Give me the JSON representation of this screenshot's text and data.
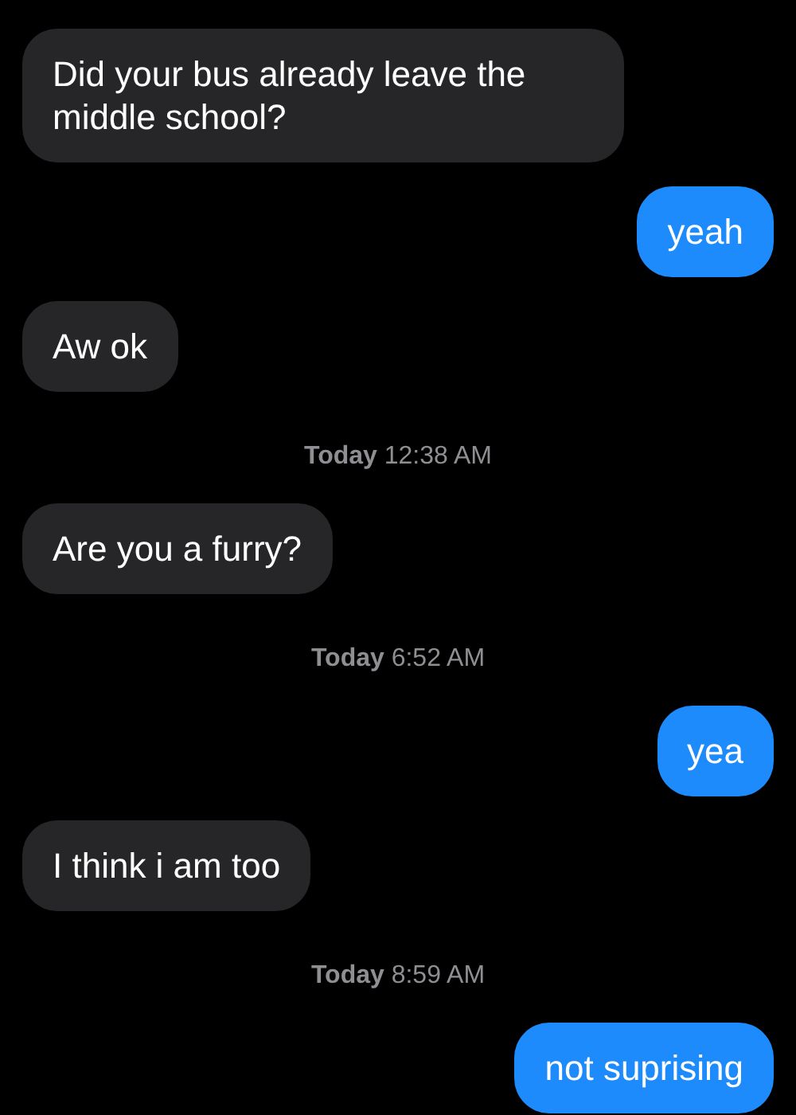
{
  "messages": [
    {
      "kind": "incoming",
      "text": "Did your bus already leave the middle school?"
    },
    {
      "kind": "outgoing",
      "text": "yeah"
    },
    {
      "kind": "incoming",
      "text": "Aw ok"
    },
    {
      "kind": "timestamp",
      "text": "**Today** 12:38 AM"
    },
    {
      "kind": "incoming",
      "text": "Are you a furry?"
    },
    {
      "kind": "timestamp",
      "text": "**Today** 6:52 AM"
    },
    {
      "kind": "outgoing",
      "text": "yea"
    },
    {
      "kind": "incoming",
      "text": "I think i am too"
    },
    {
      "kind": "timestamp",
      "text": "**Today** 8:59 AM"
    },
    {
      "kind": "outgoing",
      "text": "not suprising"
    }
  ]
}
